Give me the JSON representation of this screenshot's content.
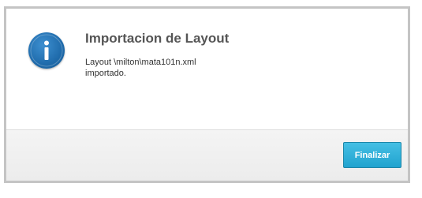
{
  "dialog": {
    "icon": "info-icon",
    "title": "Importacion de Layout",
    "message_line1": "Layout \\milton\\mata101n.xml",
    "message_line2": "importado.",
    "finish_label": "Finalizar",
    "accent_color": "#2aa9d6",
    "icon_color": "#1f6bab"
  }
}
